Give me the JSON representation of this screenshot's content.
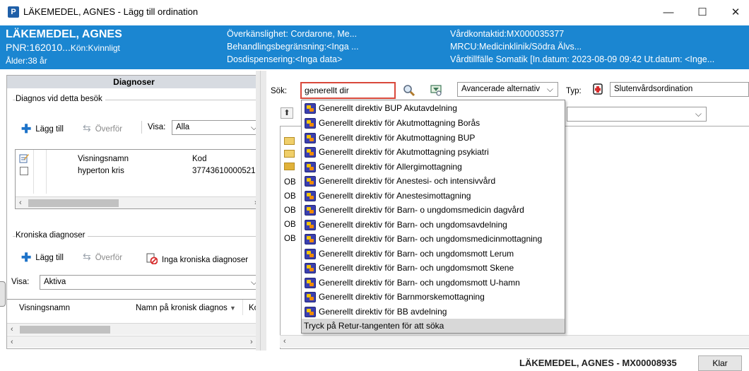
{
  "window": {
    "app_icon": "P",
    "title": "LÄKEMEDEL, AGNES - Lägg till ordination",
    "minimize": "—",
    "maximize": "☐",
    "close": "✕"
  },
  "patient": {
    "name": "LÄKEMEDEL, AGNES",
    "pnr": "PNR:162010...",
    "kon": "Kön:Kvinnligt",
    "age": "Ålder:38 år",
    "overkanslighet": "Överkänslighet: Cordarone, Me...",
    "behandlingsbegransning": "Behandlingsbegränsning:<Inga ...",
    "dosdispensering": "Dosdispensering:<Inga data>",
    "vardkontakt": "Vårdkontaktid:MX000035377",
    "mrcu": "MRCU:Medicinklinik/Södra Älvs...",
    "vardtillfalle": "Vårdtillfälle Somatik [In.datum: 2023-08-09 09:42 Ut.datum: <Inge..."
  },
  "diagnoser": {
    "header": "Diagnoser",
    "besok": {
      "group_label": "Diagnos vid detta besök",
      "add_label": "Lägg till",
      "transfer_label": "Överför",
      "visa_label": "Visa:",
      "visa_value": "Alla",
      "columns": [
        "Visningsnamn",
        "Kod"
      ],
      "rows": [
        {
          "name": "hyperton kris",
          "code": "37743610000521"
        }
      ]
    },
    "kroniska": {
      "group_label": "Kroniska diagnoser",
      "add_label": "Lägg till",
      "transfer_label": "Överför",
      "none_label": "Inga kroniska diagnoser",
      "visa_label": "Visa:",
      "visa_value": "Aktiva",
      "columns": [
        "Visningsnamn",
        "Namn på kronisk diagnos",
        "Kc"
      ]
    }
  },
  "search": {
    "label": "Sök:",
    "value": "generellt dir",
    "advanced": "Avancerade alternativ",
    "typ_label": "Typ:",
    "typ_value": "Slutenvårdsordination",
    "tree_prefix": [
      "OB",
      "OB",
      "OB",
      "OB",
      "OB"
    ],
    "suggestions": [
      "Generellt direktiv BUP Akutavdelning",
      "Generellt direktiv för Akutmottagning Borås",
      "Generellt direktiv för Akutmottagning BUP",
      "Generellt direktiv för Akutmottagning psykiatri",
      "Generellt direktiv för Allergimottagning",
      "Generellt direktiv för Anestesi- och intensivvård",
      "Generellt direktiv för Anestesimottagning",
      "Generellt direktiv för Barn- o ungdomsmedicin dagvård",
      "Generellt direktiv för Barn- och ungdomsavdelning",
      "Generellt direktiv för Barn- och ungdomsmedicinmottagning",
      "Generellt direktiv för Barn- och ungdomsmott Lerum",
      "Generellt direktiv för Barn- och ungdomsmott Skene",
      "Generellt direktiv för Barn- och ungdomsmott U-hamn",
      "Generellt direktiv för Barnmorskemottagning",
      "Generellt direktiv för BB avdelning"
    ],
    "hint": "Tryck på Retur-tangenten för att söka"
  },
  "footer": {
    "patient": "LÄKEMEDEL, AGNES - MX00008935",
    "done": "Klar"
  },
  "icons": {
    "search": "search-icon",
    "filter": "filter-icon",
    "typ": "ordination-type-icon",
    "up": "folder-up-icon"
  },
  "colors": {
    "header_bg": "#1b86d1",
    "search_border": "#d9483b",
    "add_icon": "#1d73c9"
  }
}
